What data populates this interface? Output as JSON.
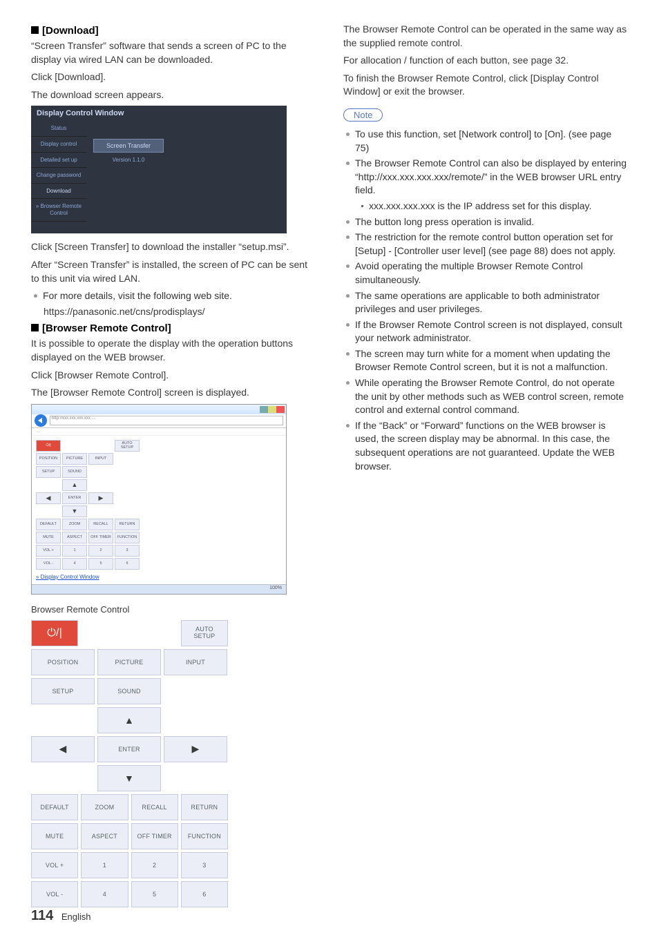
{
  "left": {
    "download_heading": "[Download]",
    "p1": "“Screen Transfer” software that sends a screen of PC to the display via wired LAN can be downloaded.",
    "p2": "Click [Download].",
    "p3": "The download screen appears.",
    "dark_panel": {
      "title": "Display Control Window",
      "sidebar": [
        "Status",
        "Display control",
        "Detailed set up",
        "Change password",
        "Download",
        "» Browser Remote Control"
      ],
      "button": "Screen Transfer",
      "version": "Version 1.1.0"
    },
    "p4": "Click [Screen Transfer] to download the installer “setup.msi”.",
    "p5": "After “Screen Transfer” is installed, the screen of PC can be sent to this unit via wired LAN.",
    "b1": "For more details, visit the following web site.",
    "url1": "https://panasonic.net/cns/prodisplays/",
    "brc_heading": "[Browser Remote Control]",
    "p6": "It is possible to operate the display with the operation buttons displayed on the WEB browser.",
    "p7": "Click [Browser Remote Control].",
    "p8": "The [Browser Remote Control] screen is displayed.",
    "browser_shot": {
      "url_hint": "http://xxx.xxx.xxx.xxx …",
      "menu_hint": "…",
      "link": "» Display Control Window",
      "zoom": "100%"
    },
    "mini_buttons": {
      "power": "⏻/|",
      "autosetup": "AUTO SETUP",
      "position": "POSITION",
      "picture": "PICTURE",
      "input": "INPUT",
      "setup": "SETUP",
      "sound": "SOUND",
      "up": "▲",
      "left": "◀",
      "enter": "ENTER",
      "right": "▶",
      "down": "▼",
      "default": "DEFAULT",
      "zoom": "ZOOM",
      "recall": "RECALL",
      "return": "RETURN",
      "mute": "MUTE",
      "aspect": "ASPECT",
      "offtimer": "OFF TIMER",
      "function": "FUNCTION",
      "volp": "VOL +",
      "n1": "1",
      "n2": "2",
      "n3": "3",
      "volm": "VOL -",
      "n4": "4",
      "n5": "5",
      "n6": "6"
    },
    "remote_label": "Browser Remote Control",
    "remote": {
      "power": "⏻/|",
      "autosetup": "AUTO\nSETUP",
      "position": "POSITION",
      "picture": "PICTURE",
      "input": "INPUT",
      "setup": "SETUP",
      "sound": "SOUND",
      "up": "▲",
      "left": "◀",
      "enter": "ENTER",
      "right": "▶",
      "down": "▼",
      "default": "DEFAULT",
      "zoom": "ZOOM",
      "recall": "RECALL",
      "return": "RETURN",
      "mute": "MUTE",
      "aspect": "ASPECT",
      "offtimer": "OFF TIMER",
      "function": "FUNCTION",
      "volp": "VOL +",
      "n1": "1",
      "n2": "2",
      "n3": "3",
      "volm": "VOL -",
      "n4": "4",
      "n5": "5",
      "n6": "6"
    }
  },
  "right": {
    "p1": "The Browser Remote Control can be operated in the same way as the supplied remote control.",
    "p2": "For allocation / function of each button, see page 32.",
    "p3": "To finish the Browser Remote Control, click [Display Control Window] or exit the browser.",
    "note_label": "Note",
    "notes": [
      "To use this function, set [Network control] to [On]. (see page 75)",
      "The Browser Remote Control can also be displayed by entering “http://xxx.xxx.xxx.xxx/remote/” in the WEB browser URL entry field.",
      "The button long press operation is invalid.",
      "The restriction for the remote control button operation set for [Setup] - [Controller user level] (see page 88) does not apply.",
      "Avoid operating the multiple Browser Remote Control simultaneously.",
      "The same operations are applicable to both administrator privileges and user privileges.",
      "If the Browser Remote Control screen is not displayed, consult your network administrator.",
      "The screen may turn white for a moment when updating the Browser Remote Control screen, but it is not a malfunction.",
      "While operating the Browser Remote Control, do not operate the unit by other methods such as WEB control screen, remote control and external control command.",
      "If the “Back” or “Forward” functions on the WEB browser is used, the screen display may be abnormal. In this case, the subsequent operations are not guaranteed. Update the WEB browser."
    ],
    "subnote": "xxx.xxx.xxx.xxx is the IP address set for this display."
  },
  "footer": {
    "page": "114",
    "lang": "English"
  }
}
